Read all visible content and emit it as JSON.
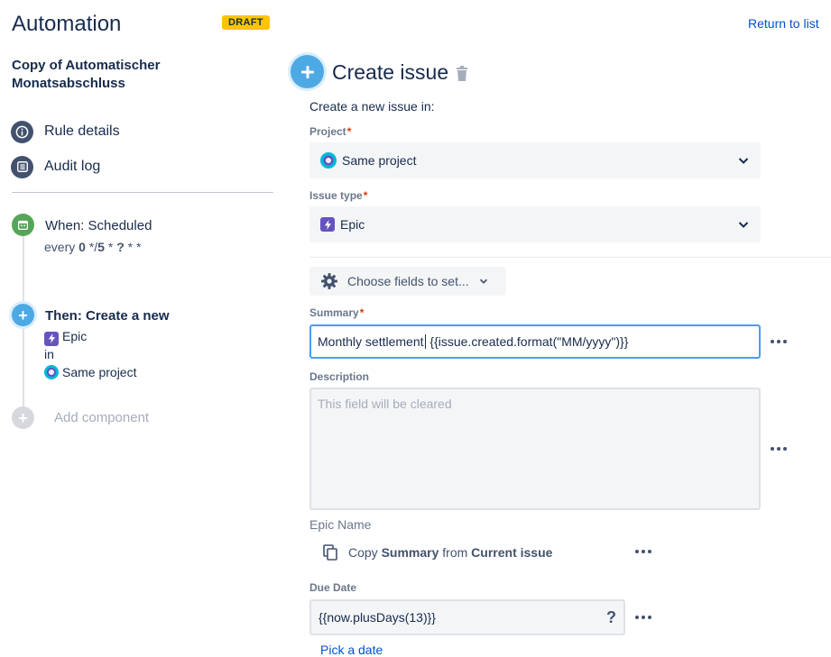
{
  "app": {
    "title": "Automation",
    "badge": "DRAFT"
  },
  "rule": {
    "name": "Copy of Automatischer Monatsabschluss"
  },
  "nav": [
    {
      "label": "Rule details",
      "icon": "info-icon"
    },
    {
      "label": "Audit log",
      "icon": "list-icon"
    }
  ],
  "trigger": {
    "title": "When: Scheduled",
    "schedule_prefix": "every ",
    "schedule": [
      "0",
      " */",
      "5",
      " * ",
      "?",
      " * *"
    ]
  },
  "action": {
    "title": "Then: Create a new",
    "issue_type": "Epic",
    "connector": "in",
    "project": "Same project"
  },
  "add_component": "Add component",
  "header": {
    "return_link": "Return to list",
    "title": "Create issue"
  },
  "form": {
    "intro": "Create a new issue in:",
    "project": {
      "label": "Project",
      "value": "Same project"
    },
    "issue_type": {
      "label": "Issue type",
      "value": "Epic"
    },
    "choose_fields": "Choose fields to set...",
    "summary": {
      "label": "Summary",
      "value_before_caret": "Monthly settlement",
      "value_after_caret": " {{issue.created.format(\"MM/yyyy\")}}"
    },
    "description": {
      "label": "Description",
      "placeholder": "This field will be cleared"
    },
    "epic_name": {
      "label": "Epic Name",
      "copy_prefix": "Copy",
      "copy_field": "Summary",
      "copy_from": "from",
      "copy_source": "Current issue"
    },
    "due_date": {
      "label": "Due Date",
      "value": "{{now.plusDays(13)}}",
      "help": "?",
      "pick_link": "Pick a date"
    },
    "required_marker": "*"
  },
  "colors": {
    "text": "#172b4d",
    "link": "#0052cc",
    "badge": "#ffc400",
    "trigger": "#57a55a",
    "action": "#4da9e3",
    "epic": "#6554c0",
    "required": "#de350b"
  }
}
